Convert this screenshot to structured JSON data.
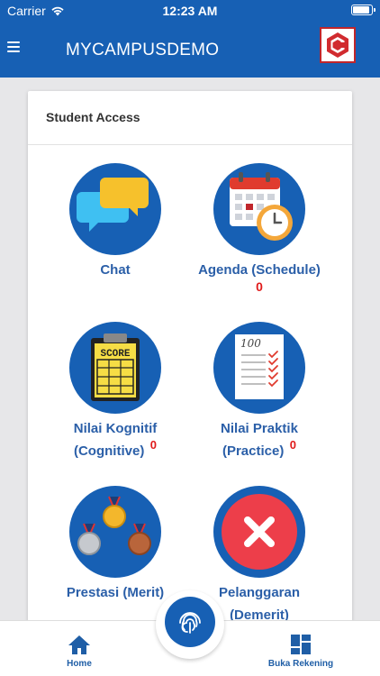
{
  "status_bar": {
    "carrier": "Carrier",
    "time": "12:23 AM"
  },
  "header": {
    "title": "MYCAMPUSDEMO"
  },
  "card": {
    "title": "Student Access",
    "tiles": [
      {
        "label_line1": "Chat",
        "label_line2": "",
        "badge": ""
      },
      {
        "label_line1": "Agenda (Schedule)",
        "label_line2": "",
        "badge": "0"
      },
      {
        "label_line1": "Nilai Kognitif",
        "label_line2": "(Cognitive)",
        "badge": "0"
      },
      {
        "label_line1": "Nilai Praktik",
        "label_line2": "(Practice)",
        "badge": "0"
      },
      {
        "label_line1": "Prestasi (Merit)",
        "label_line2": "",
        "badge": ""
      },
      {
        "label_line1": "Pelanggaran",
        "label_line2": "(Demerit)",
        "badge": ""
      }
    ]
  },
  "bottom_nav": {
    "home_label": "Home",
    "buka_rekening_label": "Buka Rekening"
  },
  "icons": {
    "score_text": "SCORE",
    "practice_text": "100"
  },
  "colors": {
    "primary": "#1760b4",
    "label": "#2b5fa8",
    "badge": "#e01b1b"
  }
}
